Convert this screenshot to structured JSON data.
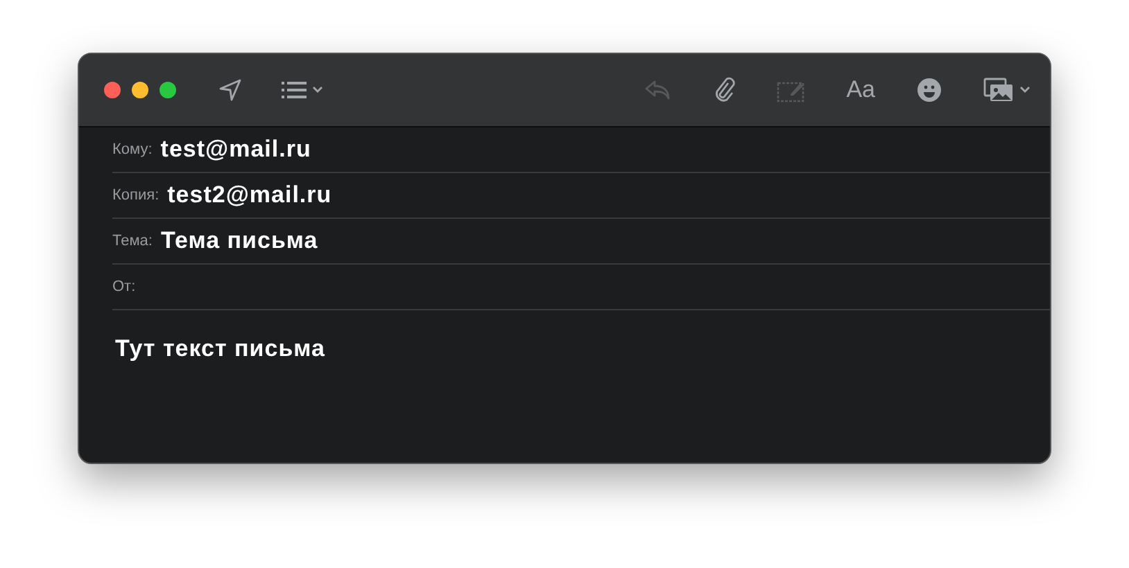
{
  "toolbar": {
    "left": [
      {
        "kind": "send",
        "disabled": false
      },
      {
        "kind": "list",
        "disabled": false
      }
    ],
    "right": [
      {
        "kind": "reply",
        "disabled": true
      },
      {
        "kind": "attach",
        "disabled": false
      },
      {
        "kind": "markup",
        "disabled": true
      },
      {
        "kind": "font",
        "label": "Aa",
        "disabled": false
      },
      {
        "kind": "emoji",
        "disabled": false
      },
      {
        "kind": "photo",
        "disabled": false
      }
    ]
  },
  "fields": [
    {
      "label": "Кому:",
      "value": "test@mail.ru"
    },
    {
      "label": "Копия:",
      "value": "test2@mail.ru"
    },
    {
      "label": "Тема:",
      "value": "Тема письма"
    },
    {
      "label": "От:"
    }
  ],
  "body": "Тут текст письма"
}
